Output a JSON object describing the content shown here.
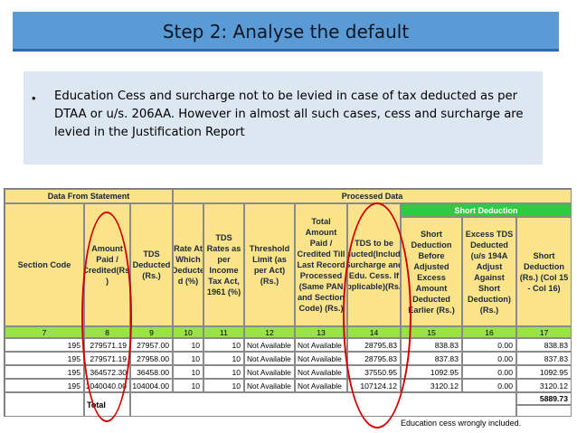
{
  "slide": {
    "title": "Step 2: Analyse the default",
    "bullet": "•",
    "bullet_text": "Education Cess and surcharge not to be levied in case of tax deducted as per DTAA or u/s. 206AA. However in almost all such cases, cess and surcharge are levied in the Justification Report"
  },
  "table": {
    "group_headers": {
      "from_statement": "Data From Statement",
      "processed": "Processed Data",
      "short_deduction": "Short Deduction"
    },
    "columns": [
      {
        "label": "Section Code",
        "number": "7"
      },
      {
        "label": "Amount Paid / Credited(Rs. )",
        "number": "8"
      },
      {
        "label": "TDS Deducted (Rs.)",
        "number": "9"
      },
      {
        "label": "Rate At Which Deducte d (%)",
        "number": "10"
      },
      {
        "label": "TDS Rates as per Income Tax Act, 1961 (%)",
        "number": "11"
      },
      {
        "label": "Threshold Limit (as per Act) (Rs.)",
        "number": "12"
      },
      {
        "label": "Total Amount Paid / Credited Till Last Record Processed (Same PAN and Section Code) (Rs.)",
        "number": "13"
      },
      {
        "label": "TDS to be Deducted(Including Surcharge and Edu. Cess. If applicable)(Rs. )",
        "number": "14"
      },
      {
        "label": "Short Deduction Before Adjusted Excess Amount Deducted Earlier (Rs.)",
        "number": "15"
      },
      {
        "label": "Excess TDS Deducted (u/s 194A Adjust Against Short Deduction) (Rs.)",
        "number": "16"
      },
      {
        "label": "Short Deduction (Rs.) (Col 15 - Col 16)",
        "number": "17"
      }
    ],
    "rows": [
      [
        "195",
        "279571.19",
        "27957.00",
        "10",
        "10",
        "Not Available",
        "Not Available",
        "28795.83",
        "838.83",
        "0.00",
        "838.83"
      ],
      [
        "195",
        "279571.19",
        "27958.00",
        "10",
        "10",
        "Not Available",
        "Not Available",
        "28795.83",
        "837.83",
        "0.00",
        "837.83"
      ],
      [
        "195",
        "364572.30",
        "36458.00",
        "10",
        "10",
        "Not Available",
        "Not Available",
        "37550.95",
        "1092.95",
        "0.00",
        "1092.95"
      ],
      [
        "195",
        "1040040.00",
        "104004.00",
        "10",
        "10",
        "Not Available",
        "Not Available",
        "107124.12",
        "3120.12",
        "0.00",
        "3120.12"
      ]
    ],
    "total_label": "Total",
    "total_value": "5889.73",
    "note": "Education cess wrongly included."
  },
  "colors": {
    "title_bar": "#5b9bd5",
    "bullet_box": "#dde7f2",
    "header_yellow": "#fbe38a",
    "header_green": "#2ecc40",
    "number_row": "#99e34a",
    "annotation": "#d10000"
  }
}
